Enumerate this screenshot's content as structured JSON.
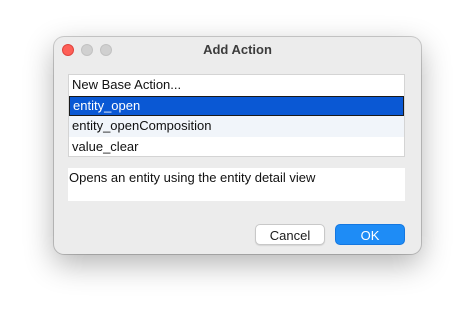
{
  "window": {
    "title": "Add Action"
  },
  "actions": {
    "items": [
      {
        "label": "New Base Action..."
      },
      {
        "label": "entity_open"
      },
      {
        "label": "entity_openComposition"
      },
      {
        "label": "value_clear"
      }
    ],
    "selected_index": 1
  },
  "description": {
    "text": "Opens an entity using the entity detail view"
  },
  "buttons": {
    "cancel_label": "Cancel",
    "ok_label": "OK"
  },
  "colors": {
    "selection": "#0a58d4",
    "ok_button": "#1e8cf6",
    "close_button": "#fe5f57"
  }
}
